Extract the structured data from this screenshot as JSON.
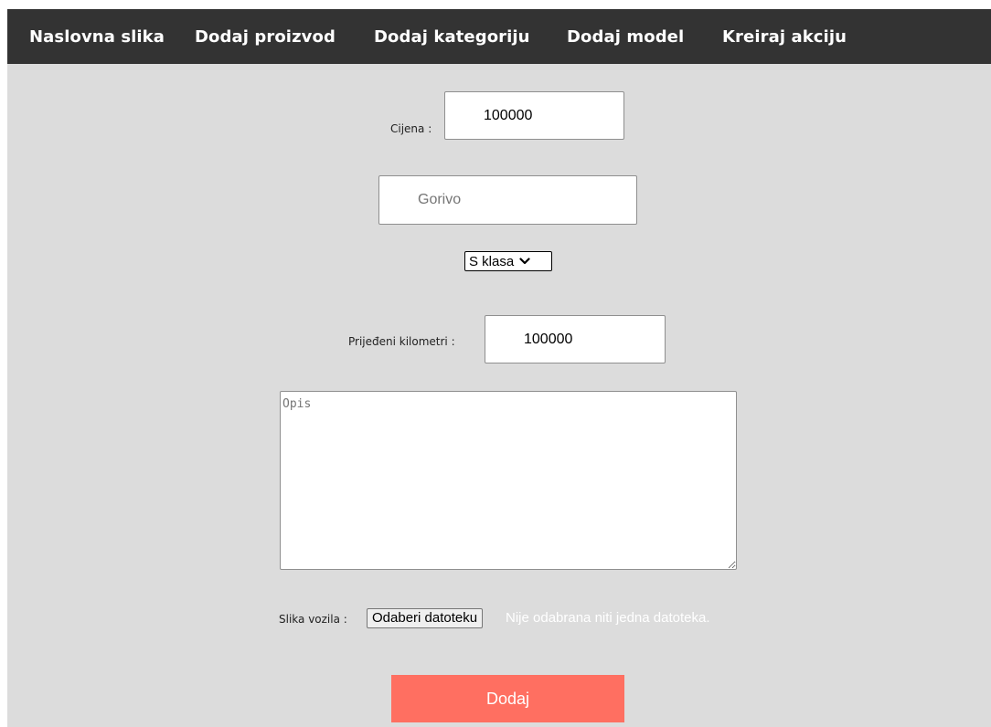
{
  "nav": {
    "items": [
      {
        "label": "Naslovna slika"
      },
      {
        "label": "Dodaj proizvod"
      },
      {
        "label": "Dodaj kategoriju"
      },
      {
        "label": "Dodaj model"
      },
      {
        "label": "Kreiraj akciju"
      }
    ]
  },
  "form": {
    "price": {
      "label": "Cijena :",
      "value": "100000"
    },
    "fuel": {
      "value": "",
      "placeholder": "Gorivo"
    },
    "model_select": {
      "selected": "S klasa"
    },
    "mileage": {
      "label": "Prijeđeni kilometri :",
      "value": "100000"
    },
    "description": {
      "value": "",
      "placeholder": "Opis"
    },
    "image": {
      "label": "Slika vozila :",
      "button_label": "Odaberi datoteku",
      "status": "Nije odabrana niti jedna datoteka."
    },
    "submit_label": "Dodaj"
  },
  "colors": {
    "navbar_bg": "#333333",
    "page_bg": "#dcdcdc",
    "submit_bg": "#ff6f61"
  }
}
